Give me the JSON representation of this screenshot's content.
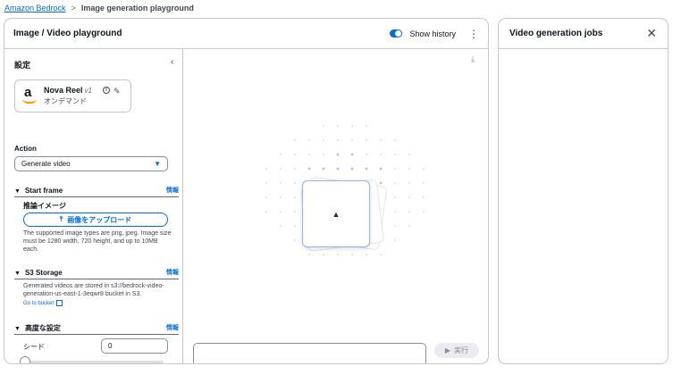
{
  "breadcrumb": {
    "root": "Amazon Bedrock",
    "separator": ">",
    "current": "Image generation playground"
  },
  "playground": {
    "title": "Image / Video playground",
    "show_history_label": "Show history",
    "more_icon": "⋮",
    "settings": {
      "title": "設定",
      "collapse_icon": "‹",
      "model": {
        "name": "Nova Reel",
        "version": "v1",
        "mode": "オンデマンド"
      },
      "action_label": "Action",
      "action_value": "Generate video",
      "start_frame": {
        "title": "Start frame",
        "info": "情報",
        "ref_label": "推論イメージ",
        "upload_label": "画像をアップロード",
        "help_lines": [
          "The supported image types are png, jpeg. Image size",
          "must be 1280 width, 720 height, and up to 10MB",
          "each."
        ]
      },
      "s3": {
        "title": "S3 Storage",
        "info": "情報",
        "desc_lines": [
          "Generated videos are stored in s3://bedrock-video-",
          "generation-us-east-1-3eqwr8 bucket in S3."
        ],
        "link": "Go to bucket"
      },
      "advanced": {
        "title": "高度な設定",
        "info": "情報",
        "seed_label": "シード",
        "seed_value": "0"
      }
    },
    "run_label": "実行"
  },
  "jobs": {
    "title": "Video generation jobs",
    "close_icon": "✕"
  },
  "colors": {
    "accent": "#006ce0",
    "border": "#c6c6cd",
    "text": "#0f141a"
  }
}
